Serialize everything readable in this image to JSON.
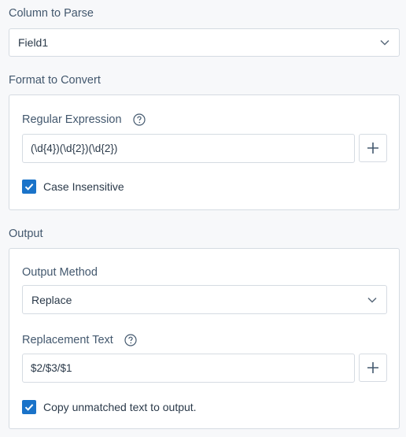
{
  "column_to_parse": {
    "label": "Column to Parse",
    "value": "Field1"
  },
  "format_to_convert": {
    "label": "Format to Convert",
    "regex_label": "Regular Expression",
    "regex_value": "(\\d{4})(\\d{2})(\\d{2})",
    "case_insensitive_label": "Case Insensitive",
    "case_insensitive_checked": true
  },
  "output": {
    "label": "Output",
    "method_label": "Output Method",
    "method_value": "Replace",
    "replacement_label": "Replacement Text",
    "replacement_value": "$2/$3/$1",
    "copy_unmatched_label": "Copy unmatched text to output.",
    "copy_unmatched_checked": true
  },
  "icons": {
    "dropdown": "chevron-down-icon",
    "help": "help-circle-icon",
    "add": "plus-icon",
    "check": "checkmark-icon"
  },
  "colors": {
    "accent": "#1a73c9",
    "label": "#43586e",
    "border": "#d5dbe2",
    "background": "#f7f8fa"
  }
}
